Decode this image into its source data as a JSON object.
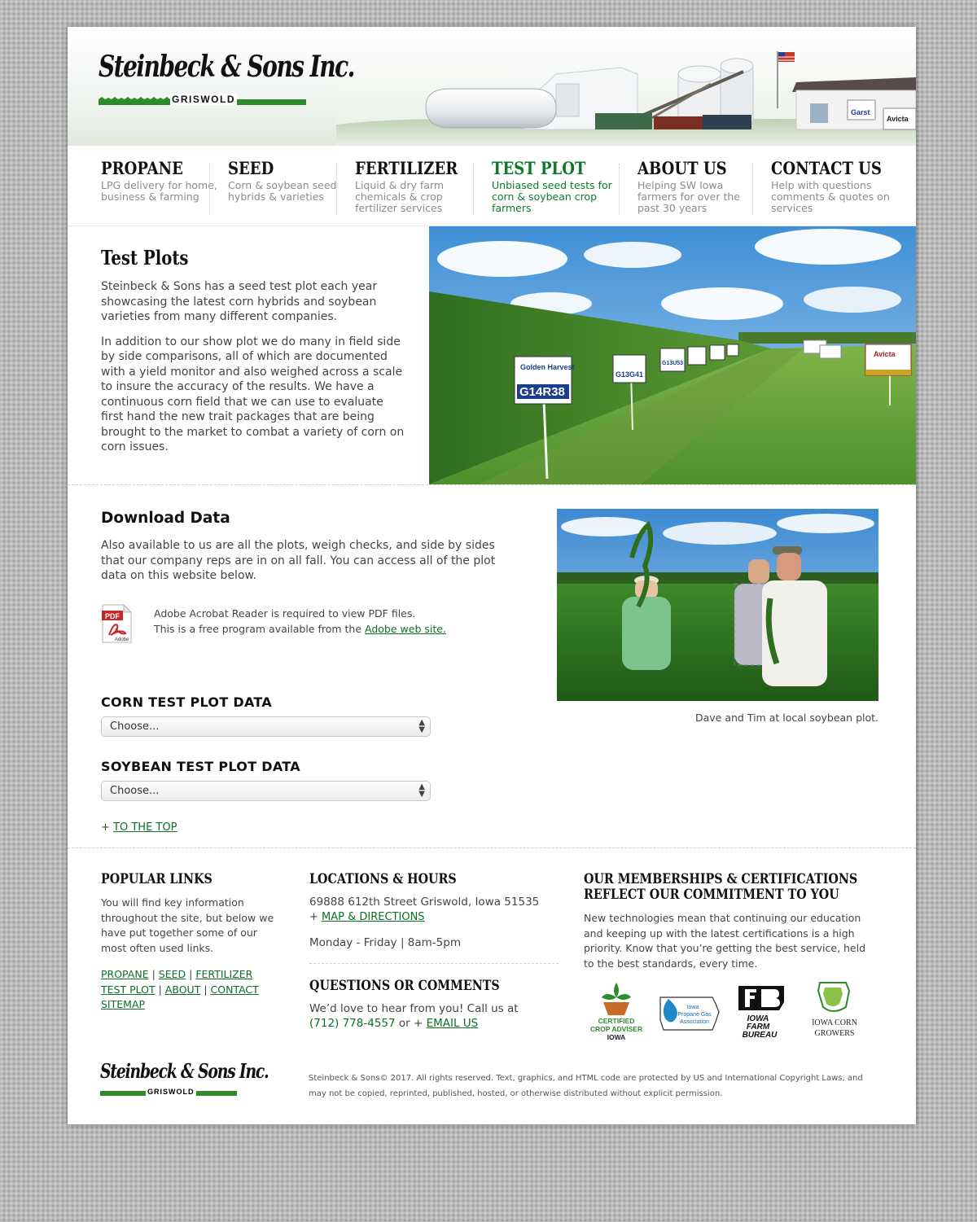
{
  "brand": {
    "name": "Steinbeck & Sons Inc.",
    "location": "GRISWOLD"
  },
  "header": {
    "sign_garst": "Garst",
    "sign_avicta": "Avicta"
  },
  "nav": [
    {
      "title": "PROPANE",
      "desc": "LPG delivery for home, business & farming"
    },
    {
      "title": "SEED",
      "desc": "Corn & soybean seed hybrids & varieties"
    },
    {
      "title": "FERTILIZER",
      "desc": "Liquid & dry farm chemicals & crop fertilizer services"
    },
    {
      "title": "TEST PLOT",
      "desc": "Unbiased seed tests for corn & soybean crop farmers"
    },
    {
      "title": "ABOUT US",
      "desc": "Helping SW Iowa farmers for over the past 30 years"
    },
    {
      "title": "CONTACT US",
      "desc": "Help with questions comments & quotes on services"
    }
  ],
  "test_plots": {
    "heading": "Test Plots",
    "p1": "Steinbeck & Sons has a seed test plot each year showcasing the latest corn hybrids and soybean varieties from many different companies.",
    "p2": "In addition to our show plot we do many in field side by side comparisons, all of which are documented with a yield monitor and also weighed across a scale to insure the accuracy of the results. We have a continuous corn field that we can use to evaluate first hand the new trait packages that are being brought to the market to combat a variety of corn on corn issues.",
    "signs": {
      "brand1": "Golden Harvest",
      "code1": "G14R38",
      "code2": "G13G41",
      "code3": "G13U53",
      "brand2": "Avicta"
    }
  },
  "download": {
    "heading": "Download Data",
    "body": "Also available to us are all the plots, weigh checks, and side by sides that our company reps are in on all fall. You can access all of the plot data on this website below.",
    "pdf_icon_label": "PDF",
    "pdf_icon_sub": "Adobe",
    "pdf_line1": "Adobe Acrobat Reader is required to view PDF files.",
    "pdf_line2_prefix": "This is a free program available from the ",
    "pdf_link": "Adobe web site.",
    "corn_label": "CORN TEST PLOT DATA",
    "corn_select": "Choose...",
    "soy_label": "SOYBEAN TEST PLOT DATA",
    "soy_select": "Choose...",
    "to_top_plus": "+",
    "to_top": "TO THE TOP",
    "caption": "Dave and Tim at local soybean plot."
  },
  "footer": {
    "popular": {
      "heading": "POPULAR LINKS",
      "text": "You will find key information throughout the site, but below we have put together some of our most often used links.",
      "links": [
        "PROPANE",
        "SEED",
        "FERTILIZER",
        "TEST PLOT",
        "ABOUT",
        "CONTACT",
        "SITEMAP"
      ],
      "sep": "|"
    },
    "locations": {
      "heading": "LOCATIONS & HOURS",
      "address": "69888 612th Street Griswold, Iowa 51535",
      "plus": "+",
      "map_link": "MAP & DIRECTIONS",
      "hours": "Monday - Friday | 8am-5pm"
    },
    "questions": {
      "heading": "QUESTIONS OR COMMENTS",
      "text_prefix": "We’d love to hear from you! Call us at",
      "phone": "(712) 778-4557",
      "or": " or + ",
      "email_link": "EMAIL US"
    },
    "memberships": {
      "heading_line1": "OUR MEMBERSHIPS & CERTIFICATIONS",
      "heading_line2": "REFLECT OUR COMMITMENT TO YOU",
      "text": "New technologies mean that continuing our education and keeping up with the latest certifications is a high priority. Know that you’re getting the best service, held to the best standards, every time.",
      "badges": {
        "cca_1": "CERTIFIED",
        "cca_2": "CROP ADVISER",
        "cca_3": "IOWA",
        "propane_1": "Iowa",
        "propane_2": "Propane Gas",
        "propane_3": "Association",
        "farm_1": "IOWA",
        "farm_2": "FARM",
        "farm_3": "BUREAU",
        "corn_1": "IOWA CORN",
        "corn_2": "GROWERS"
      }
    },
    "copyright": "Steinbeck & Sons© 2017. All rights reserved. Text, graphics, and HTML code are protected by US and International Copyright Laws, and may not be copied, reprinted, published, hosted, or otherwise distributed without explicit permission."
  },
  "colors": {
    "accent_green": "#0d7a2a",
    "text_gray": "#444444",
    "nav_desc_gray": "#8c8c8c"
  }
}
